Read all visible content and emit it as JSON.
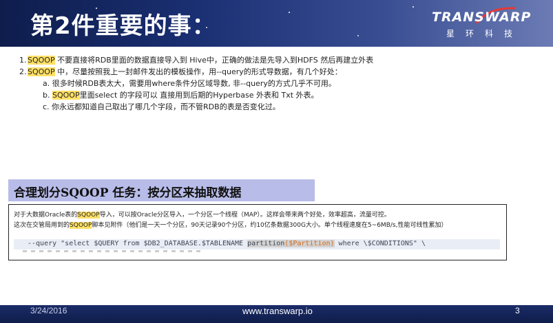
{
  "header": {
    "title": "第2件重要的事：",
    "logo_word": "TRANSWARP",
    "logo_sub": "星环科技"
  },
  "points": {
    "p1": {
      "num": "1.",
      "hl": "SQOOP",
      "text": " 不要直接将RDB里面的数据直接导入到 Hive中，正确的做法是先导入到HDFS 然后再建立外表"
    },
    "p2": {
      "num": "2.",
      "hl": "SQOOP",
      "text": " 中，尽量按照我上一封邮件发出的模板操作，用--query的形式导数据，有几个好处："
    },
    "a": {
      "text": "a. 很多时候RDB表太大，需要用where条件分区域导数, 非--query的方式几乎不可用。"
    },
    "b": {
      "pre": "b. ",
      "hl": "SQOOP",
      "text": "里面select 的字段可以 直接用到后期的Hyperbase 外表和 Txt 外表。"
    },
    "c": {
      "text": "c. 你永远都知道自己取出了哪几个字段，而不管RDB的表是否变化过。"
    }
  },
  "section": {
    "label": "合理划分SQOOP 任务：按分区来抽取数据"
  },
  "embed": {
    "line1_pre": "对于大数据Oracle表的",
    "line1_hl": "SQOOP",
    "line1_post": "导入，可以按Oracle分区导入，一个分区一个线程（MAP）。这样会带来两个好处，效率超高，流量可控。",
    "line2_pre": "这次在交管局用到的",
    "line2_hl": "SQOOP",
    "line2_post": "脚本见附件（他们是一天一个分区，90天记录90个分区，约10亿条数据300G大小。单个线程速度在5~6MB/s,性能可线性累加）",
    "code_pre": "--query \"select $QUERY from $DB2_DATABASE.$TABLENAME ",
    "code_dim1": "partition",
    "code_orange": "($Partition)",
    "code_post": " where \\$CONDITIONS\" \\"
  },
  "footer": {
    "date": "3/24/2016",
    "url": "www.transwarp.io",
    "page": "3"
  },
  "colors": {
    "header_bg": "#1a2f72",
    "highlight": "#ffe066",
    "section_bg": "#b8bce8",
    "footer_bg": "#0f1d4a"
  }
}
